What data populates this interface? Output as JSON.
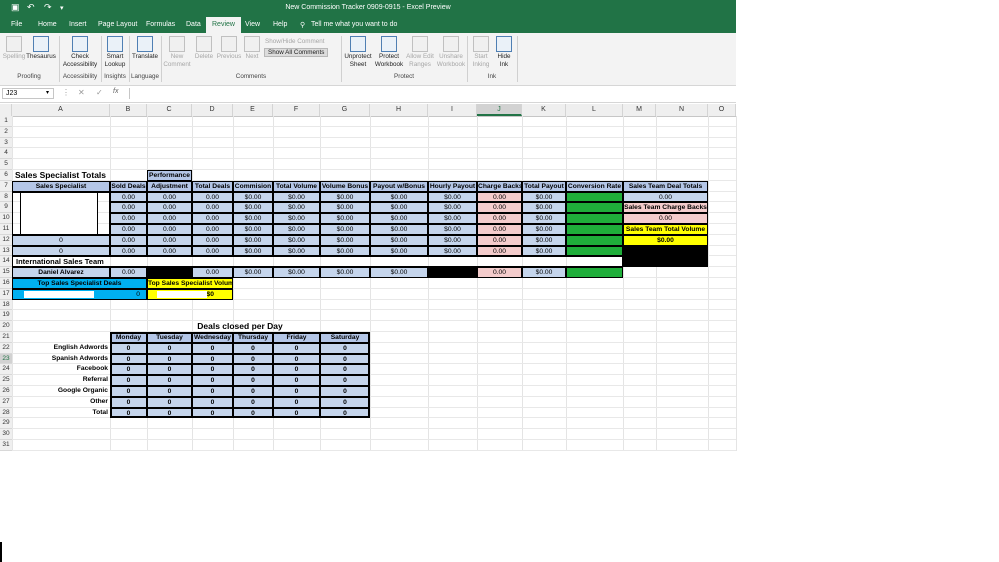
{
  "window": {
    "title": "New Commission Tracker 0909-0915  -  Excel Preview"
  },
  "menu": {
    "tabs": [
      "File",
      "Home",
      "Insert",
      "Page Layout",
      "Formulas",
      "Data",
      "Review",
      "View",
      "Help"
    ],
    "active": "Review",
    "tell_me": "Tell me what you want to do"
  },
  "ribbon": {
    "spelling": "Spelling",
    "thesaurus": "Thesaurus",
    "proofing": "Proofing",
    "check_accessibility": "Check Accessibility",
    "accessibility": "Accessibility",
    "smart_lookup": "Smart Lookup",
    "insights": "Insights",
    "translate": "Translate",
    "language": "Language",
    "new_comment": "New Comment",
    "delete": "Delete",
    "previous": "Previous",
    "next": "Next",
    "show_hide_comment": "Show/Hide Comment",
    "show_all_comments": "Show All Comments",
    "comments": "Comments",
    "unprotect_sheet": "Unprotect Sheet",
    "protect_workbook": "Protect Workbook",
    "allow_edit_ranges": "Allow Edit Ranges",
    "unshare_workbook": "Unshare Workbook",
    "protect": "Protect",
    "start_inking": "Start Inking",
    "hide_ink": "Hide Ink",
    "ink": "Ink"
  },
  "formula_bar": {
    "name_box": "J23",
    "formula": ""
  },
  "columns": [
    "A",
    "B",
    "C",
    "D",
    "E",
    "F",
    "G",
    "H",
    "I",
    "J",
    "K",
    "L",
    "M",
    "N",
    "O"
  ],
  "selected_column": "J",
  "selected_row": "23",
  "rows": [
    "1",
    "2",
    "3",
    "4",
    "5",
    "6",
    "7",
    "8",
    "9",
    "10",
    "11",
    "12",
    "13",
    "14",
    "15",
    "16",
    "17",
    "18",
    "19",
    "20",
    "21",
    "22",
    "23",
    "24",
    "25",
    "26",
    "27",
    "28",
    "29",
    "30",
    "31"
  ],
  "sheet": {
    "title": "Sales Specialist Totals",
    "performance_label": "Performance",
    "headers": [
      "Sales Specialist",
      "Sold Deals",
      "Adjustment",
      "Total Deals",
      "Commision",
      "Total Volume",
      "Volume Bonus",
      "Payout w/Bonus",
      "Hourly Payout",
      "Charge Backs",
      "Total Payout",
      "Conversion Rate"
    ],
    "rows": [
      [
        "",
        "0.00",
        "0.00",
        "0.00",
        "$0.00",
        "$0.00",
        "$0.00",
        "$0.00",
        "$0.00",
        "0.00",
        "$0.00",
        ""
      ],
      [
        "",
        "0.00",
        "0.00",
        "0.00",
        "$0.00",
        "$0.00",
        "$0.00",
        "$0.00",
        "$0.00",
        "0.00",
        "$0.00",
        ""
      ],
      [
        "",
        "0.00",
        "0.00",
        "0.00",
        "$0.00",
        "$0.00",
        "$0.00",
        "$0.00",
        "$0.00",
        "0.00",
        "$0.00",
        ""
      ],
      [
        "",
        "0.00",
        "0.00",
        "0.00",
        "$0.00",
        "$0.00",
        "$0.00",
        "$0.00",
        "$0.00",
        "0.00",
        "$0.00",
        ""
      ],
      [
        "0",
        "0.00",
        "0.00",
        "0.00",
        "$0.00",
        "$0.00",
        "$0.00",
        "$0.00",
        "$0.00",
        "0.00",
        "$0.00",
        ""
      ],
      [
        "0",
        "0.00",
        "0.00",
        "0.00",
        "$0.00",
        "$0.00",
        "$0.00",
        "$0.00",
        "$0.00",
        "0.00",
        "$0.00",
        ""
      ]
    ],
    "intl_title": "International Sales Team",
    "intl_row": [
      "Daniel Alvarez",
      "0.00",
      "",
      "0.00",
      "$0.00",
      "$0.00",
      "$0.00",
      "$0.00",
      "",
      "0.00",
      "$0.00",
      ""
    ],
    "team": {
      "deal_totals_label": "Sales Team Deal Totals",
      "deal_totals_value": "0.00",
      "charge_backs_label": "Sales Team Charge Backs",
      "charge_backs_value": "0.00",
      "total_volume_label": "Sales Team Total Volume",
      "total_volume_value": "$0.00"
    },
    "top_deals_label": "Top Sales Specialist Deals",
    "top_deals_value": "0",
    "top_volume_label": "Top Sales Specialist Volume",
    "top_volume_value": "$0",
    "deals_title": "Deals closed per Day",
    "days": [
      "Monday",
      "Tuesday",
      "Wednesday",
      "Thursday",
      "Friday",
      "Saturday"
    ],
    "sources": [
      {
        "label": "English Adwords",
        "values": [
          "0",
          "0",
          "0",
          "0",
          "0",
          "0"
        ]
      },
      {
        "label": "Spanish Adwords",
        "values": [
          "0",
          "0",
          "0",
          "0",
          "0",
          "0"
        ]
      },
      {
        "label": "Facebook",
        "values": [
          "0",
          "0",
          "0",
          "0",
          "0",
          "0"
        ]
      },
      {
        "label": "Referral",
        "values": [
          "0",
          "0",
          "0",
          "0",
          "0",
          "0"
        ]
      },
      {
        "label": "Google Organic",
        "values": [
          "0",
          "0",
          "0",
          "0",
          "0",
          "0"
        ]
      },
      {
        "label": "Other",
        "values": [
          "0",
          "0",
          "0",
          "0",
          "0",
          "0"
        ]
      },
      {
        "label": "Total",
        "values": [
          "0",
          "0",
          "0",
          "0",
          "0",
          "0"
        ]
      }
    ]
  },
  "colors": {
    "excel_green": "#217346",
    "header_blue": "#b4c6e7",
    "cell_blue": "#c5d5ec",
    "charge_pink": "#f4cccc",
    "conversion_green": "#1fae3a",
    "highlight_yellow": "#ffff00",
    "deals_cyan": "#00b0f0"
  }
}
